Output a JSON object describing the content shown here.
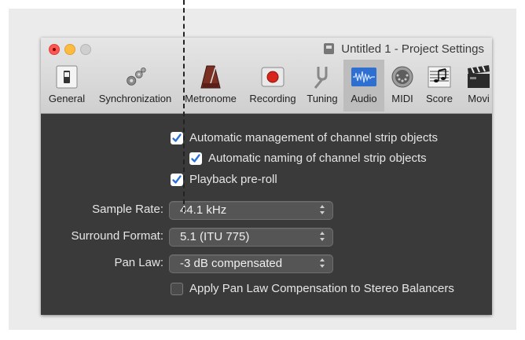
{
  "window": {
    "title": "Untitled 1 - Project Settings"
  },
  "toolbar": {
    "items": [
      {
        "label": "General",
        "icon": "switch-icon"
      },
      {
        "label": "Synchronization",
        "icon": "gears-icon"
      },
      {
        "label": "Metronome",
        "icon": "metronome-icon"
      },
      {
        "label": "Recording",
        "icon": "record-icon"
      },
      {
        "label": "Tuning",
        "icon": "tuning-fork-icon"
      },
      {
        "label": "Audio",
        "icon": "waveform-icon",
        "selected": true
      },
      {
        "label": "MIDI",
        "icon": "midi-connector-icon"
      },
      {
        "label": "Score",
        "icon": "score-icon"
      },
      {
        "label": "Movi",
        "icon": "clapperboard-icon"
      }
    ]
  },
  "audio": {
    "auto_channel_strip": {
      "label": "Automatic management of channel strip objects",
      "checked": true
    },
    "auto_naming": {
      "label": "Automatic naming of channel strip objects",
      "checked": true
    },
    "playback_preroll": {
      "label": "Playback pre-roll",
      "checked": true
    },
    "sample_rate": {
      "label": "Sample Rate:",
      "value": "44.1 kHz"
    },
    "surround_format": {
      "label": "Surround Format:",
      "value": "5.1 (ITU 775)"
    },
    "pan_law": {
      "label": "Pan Law:",
      "value": "-3 dB compensated"
    },
    "pan_law_stereo": {
      "label": "Apply Pan Law Compensation to Stereo Balancers",
      "checked": false
    }
  },
  "colors": {
    "checkbox_accent": "#2a6fd6",
    "window_background": "#3a3a3a"
  }
}
